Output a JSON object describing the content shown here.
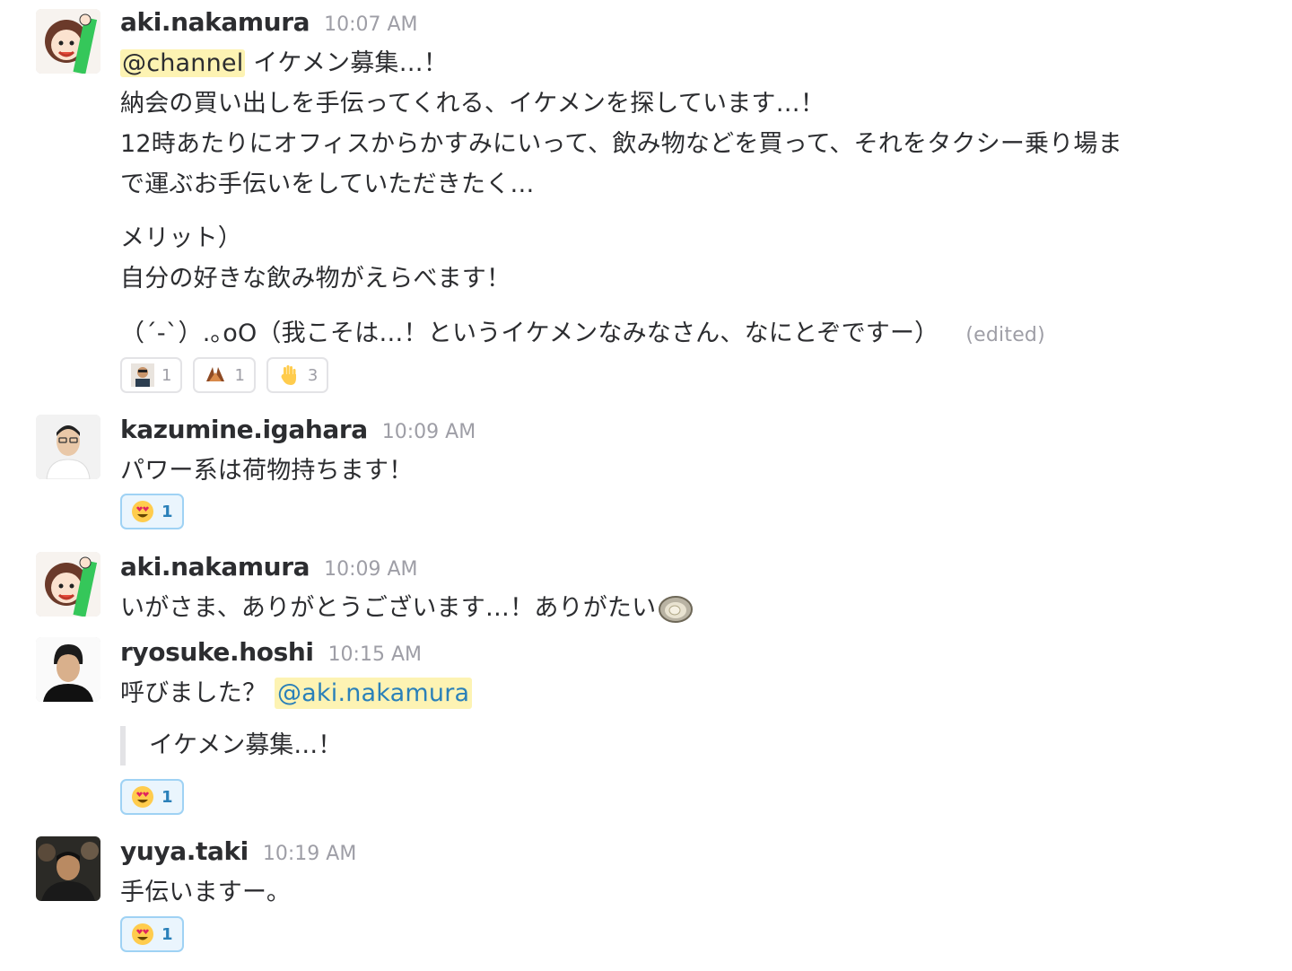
{
  "messages": [
    {
      "user": "aki.nakamura",
      "time": "10:07 AM",
      "mention": "@channel",
      "line1_rest": " イケメン募集…！",
      "line2": "納会の買い出しを手伝ってくれる、イケメンを探しています…！",
      "line3": "12時あたりにオフィスからかすみにいって、飲み物などを買って、それをタクシー乗り場ま",
      "line4": "で運ぶお手伝いをしていただきたく…",
      "line5": "メリット）",
      "line6": "自分の好きな飲み物がえらべます！",
      "line7": "（´-`）.｡oO（我こそは…！というイケメンなみなさん、なにとぞですー）",
      "edited": "(edited)",
      "reactions": [
        {
          "emoji": "person-custom-emoji",
          "count": "1"
        },
        {
          "emoji": "oyster-custom-emoji",
          "count": "1"
        },
        {
          "emoji": "raised-hand-emoji",
          "count": "3"
        }
      ]
    },
    {
      "user": "kazumine.igahara",
      "time": "10:09 AM",
      "text": "パワー系は荷物持ちます！",
      "reactions": [
        {
          "emoji": "heart-eyes-emoji",
          "count": "1"
        }
      ]
    },
    {
      "user": "aki.nakamura",
      "time": "10:09 AM",
      "text": "いがさま、ありがとうございます…！ありがたい",
      "inline_emoji": "oyster-emoji"
    },
    {
      "user": "ryosuke.hoshi",
      "time": "10:15 AM",
      "text": "呼びました？ ",
      "mention": "@aki.nakamura",
      "quote": "イケメン募集…！",
      "reactions": [
        {
          "emoji": "heart-eyes-emoji",
          "count": "1"
        }
      ]
    },
    {
      "user": "yuya.taki",
      "time": "10:19 AM",
      "text": "手伝いますー。",
      "reactions": [
        {
          "emoji": "heart-eyes-emoji",
          "count": "1"
        }
      ]
    }
  ],
  "colors": {
    "text": "#2c2d30",
    "timestamp": "#9e9ea6",
    "mention_bg": "#fdf3b3",
    "mention_link": "#2a80b9",
    "reaction_active_border": "#9fd2f4",
    "reaction_active_bg": "#eaf5fd"
  }
}
